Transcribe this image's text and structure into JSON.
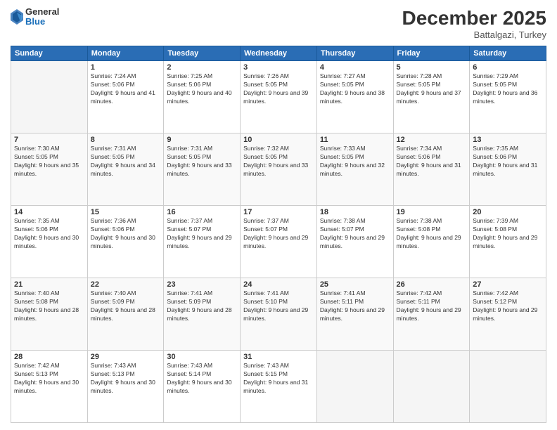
{
  "logo": {
    "general": "General",
    "blue": "Blue"
  },
  "header": {
    "month_year": "December 2025",
    "location": "Battalgazi, Turkey"
  },
  "days_of_week": [
    "Sunday",
    "Monday",
    "Tuesday",
    "Wednesday",
    "Thursday",
    "Friday",
    "Saturday"
  ],
  "weeks": [
    [
      {
        "day": "",
        "sunrise": "",
        "sunset": "",
        "daylight": ""
      },
      {
        "day": "1",
        "sunrise": "Sunrise: 7:24 AM",
        "sunset": "Sunset: 5:06 PM",
        "daylight": "Daylight: 9 hours and 41 minutes."
      },
      {
        "day": "2",
        "sunrise": "Sunrise: 7:25 AM",
        "sunset": "Sunset: 5:06 PM",
        "daylight": "Daylight: 9 hours and 40 minutes."
      },
      {
        "day": "3",
        "sunrise": "Sunrise: 7:26 AM",
        "sunset": "Sunset: 5:05 PM",
        "daylight": "Daylight: 9 hours and 39 minutes."
      },
      {
        "day": "4",
        "sunrise": "Sunrise: 7:27 AM",
        "sunset": "Sunset: 5:05 PM",
        "daylight": "Daylight: 9 hours and 38 minutes."
      },
      {
        "day": "5",
        "sunrise": "Sunrise: 7:28 AM",
        "sunset": "Sunset: 5:05 PM",
        "daylight": "Daylight: 9 hours and 37 minutes."
      },
      {
        "day": "6",
        "sunrise": "Sunrise: 7:29 AM",
        "sunset": "Sunset: 5:05 PM",
        "daylight": "Daylight: 9 hours and 36 minutes."
      }
    ],
    [
      {
        "day": "7",
        "sunrise": "Sunrise: 7:30 AM",
        "sunset": "Sunset: 5:05 PM",
        "daylight": "Daylight: 9 hours and 35 minutes."
      },
      {
        "day": "8",
        "sunrise": "Sunrise: 7:31 AM",
        "sunset": "Sunset: 5:05 PM",
        "daylight": "Daylight: 9 hours and 34 minutes."
      },
      {
        "day": "9",
        "sunrise": "Sunrise: 7:31 AM",
        "sunset": "Sunset: 5:05 PM",
        "daylight": "Daylight: 9 hours and 33 minutes."
      },
      {
        "day": "10",
        "sunrise": "Sunrise: 7:32 AM",
        "sunset": "Sunset: 5:05 PM",
        "daylight": "Daylight: 9 hours and 33 minutes."
      },
      {
        "day": "11",
        "sunrise": "Sunrise: 7:33 AM",
        "sunset": "Sunset: 5:05 PM",
        "daylight": "Daylight: 9 hours and 32 minutes."
      },
      {
        "day": "12",
        "sunrise": "Sunrise: 7:34 AM",
        "sunset": "Sunset: 5:06 PM",
        "daylight": "Daylight: 9 hours and 31 minutes."
      },
      {
        "day": "13",
        "sunrise": "Sunrise: 7:35 AM",
        "sunset": "Sunset: 5:06 PM",
        "daylight": "Daylight: 9 hours and 31 minutes."
      }
    ],
    [
      {
        "day": "14",
        "sunrise": "Sunrise: 7:35 AM",
        "sunset": "Sunset: 5:06 PM",
        "daylight": "Daylight: 9 hours and 30 minutes."
      },
      {
        "day": "15",
        "sunrise": "Sunrise: 7:36 AM",
        "sunset": "Sunset: 5:06 PM",
        "daylight": "Daylight: 9 hours and 30 minutes."
      },
      {
        "day": "16",
        "sunrise": "Sunrise: 7:37 AM",
        "sunset": "Sunset: 5:07 PM",
        "daylight": "Daylight: 9 hours and 29 minutes."
      },
      {
        "day": "17",
        "sunrise": "Sunrise: 7:37 AM",
        "sunset": "Sunset: 5:07 PM",
        "daylight": "Daylight: 9 hours and 29 minutes."
      },
      {
        "day": "18",
        "sunrise": "Sunrise: 7:38 AM",
        "sunset": "Sunset: 5:07 PM",
        "daylight": "Daylight: 9 hours and 29 minutes."
      },
      {
        "day": "19",
        "sunrise": "Sunrise: 7:38 AM",
        "sunset": "Sunset: 5:08 PM",
        "daylight": "Daylight: 9 hours and 29 minutes."
      },
      {
        "day": "20",
        "sunrise": "Sunrise: 7:39 AM",
        "sunset": "Sunset: 5:08 PM",
        "daylight": "Daylight: 9 hours and 29 minutes."
      }
    ],
    [
      {
        "day": "21",
        "sunrise": "Sunrise: 7:40 AM",
        "sunset": "Sunset: 5:08 PM",
        "daylight": "Daylight: 9 hours and 28 minutes."
      },
      {
        "day": "22",
        "sunrise": "Sunrise: 7:40 AM",
        "sunset": "Sunset: 5:09 PM",
        "daylight": "Daylight: 9 hours and 28 minutes."
      },
      {
        "day": "23",
        "sunrise": "Sunrise: 7:41 AM",
        "sunset": "Sunset: 5:09 PM",
        "daylight": "Daylight: 9 hours and 28 minutes."
      },
      {
        "day": "24",
        "sunrise": "Sunrise: 7:41 AM",
        "sunset": "Sunset: 5:10 PM",
        "daylight": "Daylight: 9 hours and 29 minutes."
      },
      {
        "day": "25",
        "sunrise": "Sunrise: 7:41 AM",
        "sunset": "Sunset: 5:11 PM",
        "daylight": "Daylight: 9 hours and 29 minutes."
      },
      {
        "day": "26",
        "sunrise": "Sunrise: 7:42 AM",
        "sunset": "Sunset: 5:11 PM",
        "daylight": "Daylight: 9 hours and 29 minutes."
      },
      {
        "day": "27",
        "sunrise": "Sunrise: 7:42 AM",
        "sunset": "Sunset: 5:12 PM",
        "daylight": "Daylight: 9 hours and 29 minutes."
      }
    ],
    [
      {
        "day": "28",
        "sunrise": "Sunrise: 7:42 AM",
        "sunset": "Sunset: 5:13 PM",
        "daylight": "Daylight: 9 hours and 30 minutes."
      },
      {
        "day": "29",
        "sunrise": "Sunrise: 7:43 AM",
        "sunset": "Sunset: 5:13 PM",
        "daylight": "Daylight: 9 hours and 30 minutes."
      },
      {
        "day": "30",
        "sunrise": "Sunrise: 7:43 AM",
        "sunset": "Sunset: 5:14 PM",
        "daylight": "Daylight: 9 hours and 30 minutes."
      },
      {
        "day": "31",
        "sunrise": "Sunrise: 7:43 AM",
        "sunset": "Sunset: 5:15 PM",
        "daylight": "Daylight: 9 hours and 31 minutes."
      },
      {
        "day": "",
        "sunrise": "",
        "sunset": "",
        "daylight": ""
      },
      {
        "day": "",
        "sunrise": "",
        "sunset": "",
        "daylight": ""
      },
      {
        "day": "",
        "sunrise": "",
        "sunset": "",
        "daylight": ""
      }
    ]
  ]
}
